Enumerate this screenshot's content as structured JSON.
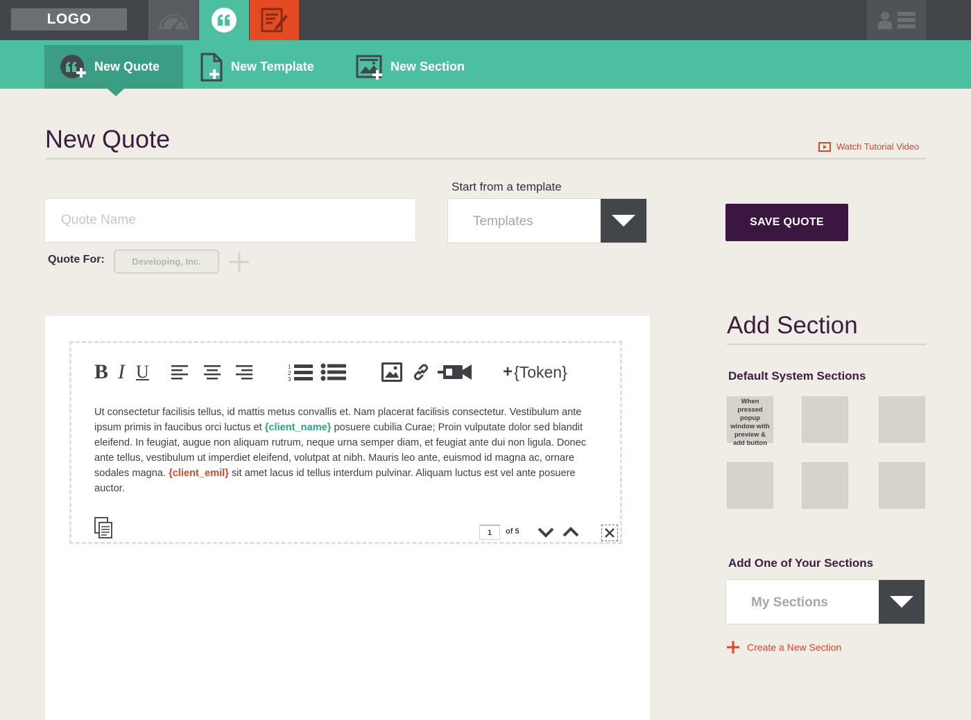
{
  "app": {
    "logo_text": "LOGO"
  },
  "top_tabs": [
    {
      "icon": "speedometer-icon",
      "color": "#595d61"
    },
    {
      "icon": "quote-icon",
      "color": "#4bbf9f"
    },
    {
      "icon": "edit-document-icon",
      "color": "#e44b23"
    }
  ],
  "subnav": {
    "new_quote": "New Quote",
    "new_template": "New Template",
    "new_section": "New Section"
  },
  "page": {
    "title": "New Quote",
    "tutorial_link": "Watch Tutorial Video"
  },
  "form": {
    "quote_name_placeholder": "Quote Name",
    "quote_name_value": "",
    "quote_for_label": "Quote For:",
    "client_chip": "Developing, Inc.",
    "template_label": "Start from a template",
    "template_select_value": "Templates",
    "save_label": "SAVE QUOTE"
  },
  "editor": {
    "toolbar": {
      "bold": "B",
      "italic": "I",
      "underline": "U",
      "token_label": "{Token}",
      "token_plus": "+"
    },
    "text_parts": {
      "p1": "Ut consectetur facilisis tellus, id mattis metus convallis et. Nam placerat facilisis consectetur. Vestibulum ante ipsum primis in faucibus orci luctus et ",
      "token1": "{client_name}",
      "p2": " posuere cubilia Curae; Proin vulputate dolor sed blandit eleifend. In feugiat, augue non aliquam rutrum, neque urna semper diam, et feugiat ante dui non ligula. Donec ante tellus, vestibulum ut imperdiet eleifend, volutpat at nibh. Mauris leo ante, euismod id magna ac, ornare sodales magna. ",
      "token2": "{client_emil}",
      "p3": " sit amet lacus id tellus interdum pulvinar. Aliquam luctus est vel ante posuere auctor."
    },
    "pager": {
      "current_page": "1",
      "of_label": "of 5"
    }
  },
  "sidebar": {
    "title": "Add Section",
    "default_sections_label": "Default System Sections",
    "first_thumb_text": "When pressed popup window with preview & add button",
    "own_sections_label": "Add One of Your Sections",
    "my_sections_value": "My Sections",
    "create_section_label": "Create a New Section"
  },
  "colors": {
    "accent_green": "#4bbf9f",
    "accent_red": "#e44b23",
    "dark_purple": "#3a1640",
    "topbar": "#42464a"
  }
}
